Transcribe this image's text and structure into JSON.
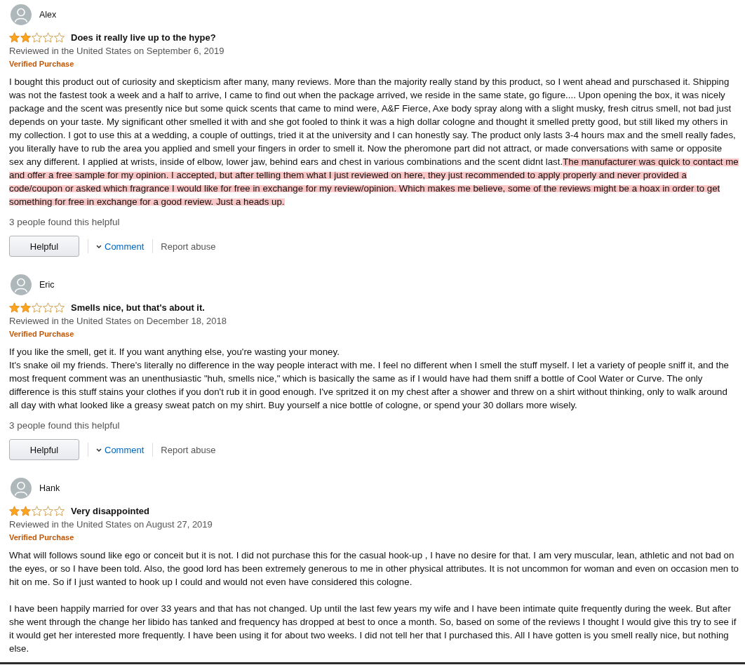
{
  "reviews": [
    {
      "author": "Alex",
      "stars": 2,
      "title": "Does it really live up to the hype?",
      "date": "Reviewed in the United States on September 6, 2019",
      "verified": "Verified Purchase",
      "body": [
        {
          "segments": [
            {
              "text": "I bought this product out of curiosity and skepticism after many, many reviews. More than the majority really stand by this product, so I went ahead and purschased it. Shipping was not the fastest took a week and a half to arrive, I came to find out when the package arrived, we reside in the same state, go figure.... Upon opening the box, it was nicely package and the scent was presently nice but some quick scents that came to mind were, A&F Fierce, Axe body spray along with a slight musky, fresh citrus smell, not bad just depends on your taste. My significant other smelled it with and she got fooled to think it was a high dollar cologne and thought it smelled pretty good, but still liked my others in my collection. I got to use this at a wedding, a couple of outtings, tried it at the university and I can honestly say. The product only lasts 3-4 hours max and the smell really fades, you literally have to rub the area you applied and smell your fingers in order to smell it. Now the pheromone part did not attract, or made conversations with same or opposite sex any different. I applied at wrists, inside of elbow, lower jaw, behind ears and chest in various combinations and the scent didnt last.",
              "highlighted": false
            },
            {
              "text": "The manufacturer was quick to contact me and offer a free sample for my opinion. I accepted, but after telling them what I just reviewed on here, they just recommended to apply properly and never provided a code/coupon or asked which fragrance I would like for free in exchange for my review/opinion. Which makes me believe, some of the reviews might be a hoax in order to get something for free in exchange for a good review. Just a heads up.",
              "highlighted": true
            }
          ]
        }
      ],
      "helpful_count": "3 people found this helpful",
      "actions": [
        {
          "kind": "button",
          "label": "Helpful"
        },
        {
          "kind": "dropdown-link",
          "label": "Comment"
        },
        {
          "kind": "link",
          "label": "Report abuse"
        }
      ]
    },
    {
      "author": "Eric",
      "stars": 2,
      "title": "Smells nice, but that's about it.",
      "date": "Reviewed in the United States on December 18, 2018",
      "verified": "Verified Purchase",
      "body": [
        {
          "segments": [
            {
              "text": "If you like the smell, get it. If you want anything else, you're wasting your money.\nIt's snake oil my friends. There's literally no difference in the way people interact with me. I feel no different when I smell the stuff myself. I let a variety of people sniff it, and the most frequent comment was an unenthusiastic \"huh, smells nice,\" which is basically the same as if I would have had them sniff a bottle of Cool Water or Curve. The only difference is this stuff stains your clothes if you don't rub it in good enough. I've spritzed it on my chest after a shower and threw on a shirt without thinking, only to walk around all day with what looked like a greasy sweat patch on my shirt. Buy yourself a nice bottle of cologne, or spend your 30 dollars more wisely.",
              "highlighted": false
            }
          ]
        }
      ],
      "helpful_count": "3 people found this helpful",
      "actions": [
        {
          "kind": "button",
          "label": "Helpful"
        },
        {
          "kind": "dropdown-link",
          "label": "Comment"
        },
        {
          "kind": "link",
          "label": "Report abuse"
        }
      ]
    },
    {
      "author": "Hank",
      "stars": 2,
      "title": "Very disappointed",
      "date": "Reviewed in the United States on August 27, 2019",
      "verified": "Verified Purchase",
      "body": [
        {
          "segments": [
            {
              "text": "What will follows sound like ego or conceit but it is not. I did not purchase this for the casual hook-up , I have no desire for that. I am very muscular, lean, athletic and not bad on the eyes, or so I have been told. Also, the good lord has been extremely generous to me in other physical attributes. It is not uncommon for woman and even on occasion men to hit on me. So if I just wanted to hook up I could and would not even have considered this cologne.",
              "highlighted": false
            }
          ]
        },
        {
          "segments": [
            {
              "text": "I have been happily married for over 33 years and that has not changed. Up until the last few years my wife and I have been intimate quite frequently during the week. But after she went through the change her libido has tanked and frequency has dropped at best to once a month. So, based on some of the reviews I thought I would give this try to see if it would get her interested more frequently. I have been using it for about two weeks. I did not tell her that I purchased this. All I have gotten is you smell really nice, but nothing else.",
              "highlighted": false
            }
          ]
        }
      ]
    }
  ]
}
